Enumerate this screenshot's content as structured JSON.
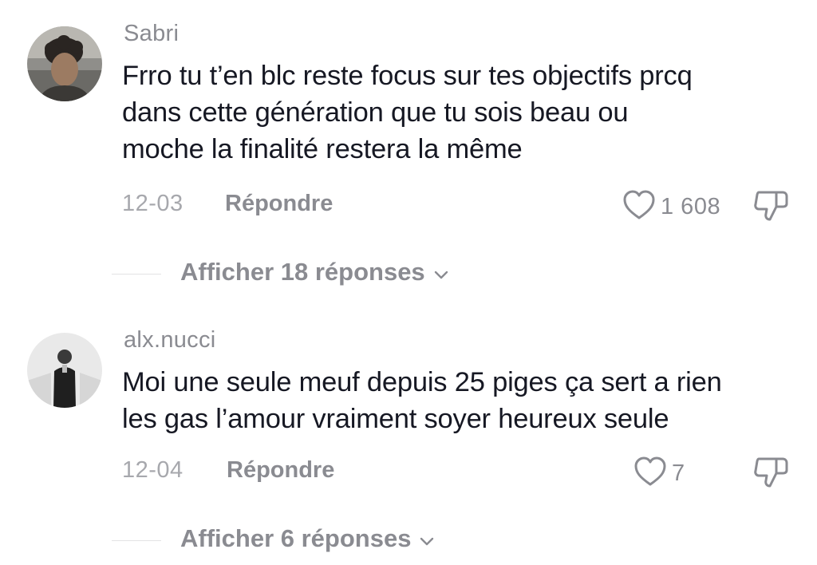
{
  "comments": [
    {
      "username": "Sabri",
      "lines": [
        "Frro tu t’en blc reste focus sur tes objectifs prcq",
        "dans cette génération que tu sois beau ou",
        "moche la finalité restera la même"
      ],
      "date": "12-03",
      "reply_label": "Répondre",
      "likes": "1 608",
      "view_replies_label": "Afficher 18 réponses"
    },
    {
      "username": "alx.nucci",
      "lines": [
        "Moi une seule meuf depuis 25 piges ça sert a rien",
        "les gas l’amour vraiment soyer heureux seule"
      ],
      "date": "12-04",
      "reply_label": "Répondre",
      "likes": "7",
      "view_replies_label": "Afficher 6 réponses"
    }
  ],
  "icons": {
    "like": "heart-outline-icon",
    "dislike": "thumbs-down-outline-icon",
    "expand": "chevron-down-icon"
  },
  "colors": {
    "text_primary": "#161823",
    "text_secondary": "#8a8b91",
    "text_tertiary": "#a7a8ad",
    "divider": "#e3e3e4"
  }
}
